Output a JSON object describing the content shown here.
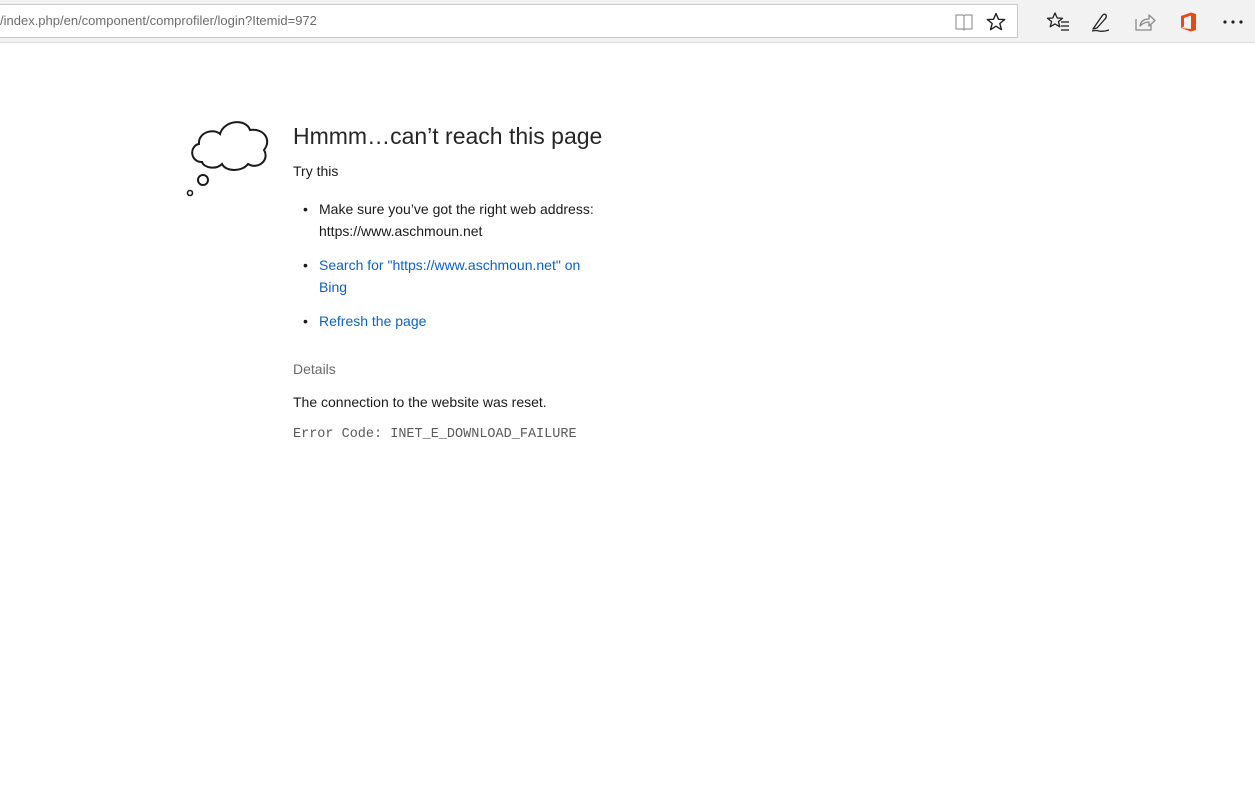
{
  "address_bar": {
    "url": "/index.php/en/component/comprofiler/login?Itemid=972"
  },
  "toolbar": {
    "icons": [
      "reading-view-icon",
      "favorite-star-icon",
      "favorites-hub-icon",
      "web-note-icon",
      "share-icon",
      "office-icon",
      "more-icon"
    ],
    "office_color": "#e64a19"
  },
  "error_page": {
    "headline": "Hmmm…can’t reach this page",
    "try_this": "Try this",
    "suggestion_1": "Make sure you’ve got the right web address: https://www.aschmoun.net",
    "suggestion_2_link": "Search for \"https://www.aschmoun.net\" on Bing",
    "suggestion_3_link": "Refresh the page",
    "details_label": "Details",
    "reset_message": "The connection to the website was reset.",
    "error_code": "Error Code: INET_E_DOWNLOAD_FAILURE",
    "link_color": "#0b63c4"
  }
}
